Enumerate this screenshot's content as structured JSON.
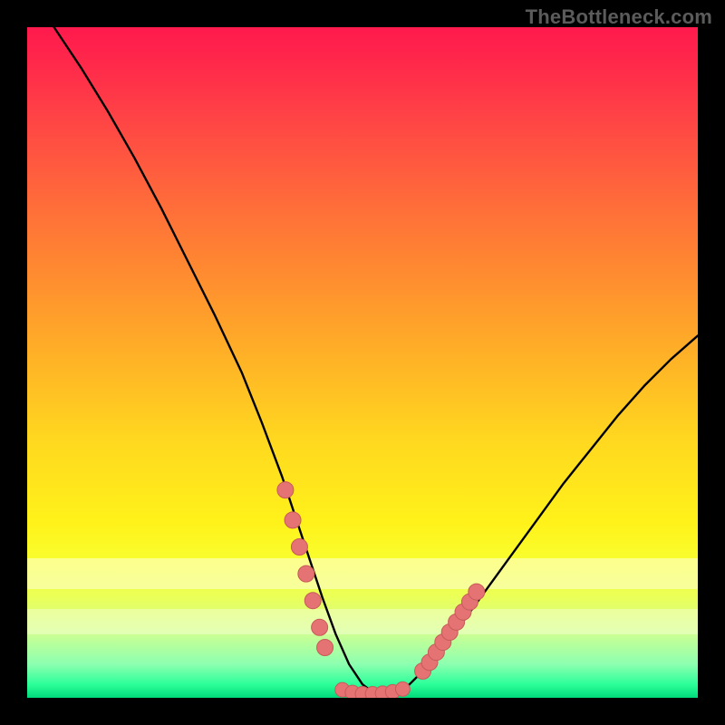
{
  "watermark": "TheBottleneck.com",
  "colors": {
    "frame_bg": "#000000",
    "curve": "#000000",
    "marker_fill": "#e57373",
    "marker_stroke": "#c85a5a",
    "gradient_top": "#ff1a4d",
    "gradient_bottom": "#00d97a"
  },
  "chart_data": {
    "type": "line",
    "title": "",
    "xlabel": "",
    "ylabel": "",
    "x_range": [
      0,
      100
    ],
    "y_range": [
      0,
      100
    ],
    "curve": {
      "name": "bottleneck-curve",
      "x": [
        4,
        8,
        12,
        16,
        20,
        24,
        28,
        32,
        35,
        38,
        40,
        42,
        44,
        46,
        48,
        50,
        52,
        54,
        57,
        60,
        64,
        68,
        72,
        76,
        80,
        84,
        88,
        92,
        96,
        100
      ],
      "y": [
        100,
        94,
        87.5,
        80.5,
        73,
        65,
        57,
        48.5,
        41,
        33,
        27,
        21,
        15,
        9.5,
        5,
        2,
        0.5,
        0.5,
        2,
        5,
        10,
        15.5,
        21,
        26.5,
        32,
        37,
        42,
        46.5,
        50.5,
        54
      ]
    },
    "markers_left": {
      "name": "left-cluster",
      "x": [
        38.5,
        39.6,
        40.6,
        41.6,
        42.6,
        43.6,
        44.4
      ],
      "y": [
        31.0,
        26.5,
        22.5,
        18.5,
        14.5,
        10.5,
        7.5
      ]
    },
    "markers_right": {
      "name": "right-cluster",
      "x": [
        59.0,
        60.0,
        61.0,
        62.0,
        63.0,
        64.0,
        65.0,
        66.0,
        67.0
      ],
      "y": [
        4.0,
        5.3,
        6.8,
        8.3,
        9.8,
        11.3,
        12.8,
        14.3,
        15.8
      ]
    },
    "markers_bottom": {
      "name": "bottom-plateau",
      "x": [
        47.0,
        48.5,
        50.0,
        51.5,
        53.0,
        54.5,
        56.0
      ],
      "y": [
        1.2,
        0.8,
        0.6,
        0.6,
        0.7,
        0.9,
        1.3
      ]
    }
  }
}
